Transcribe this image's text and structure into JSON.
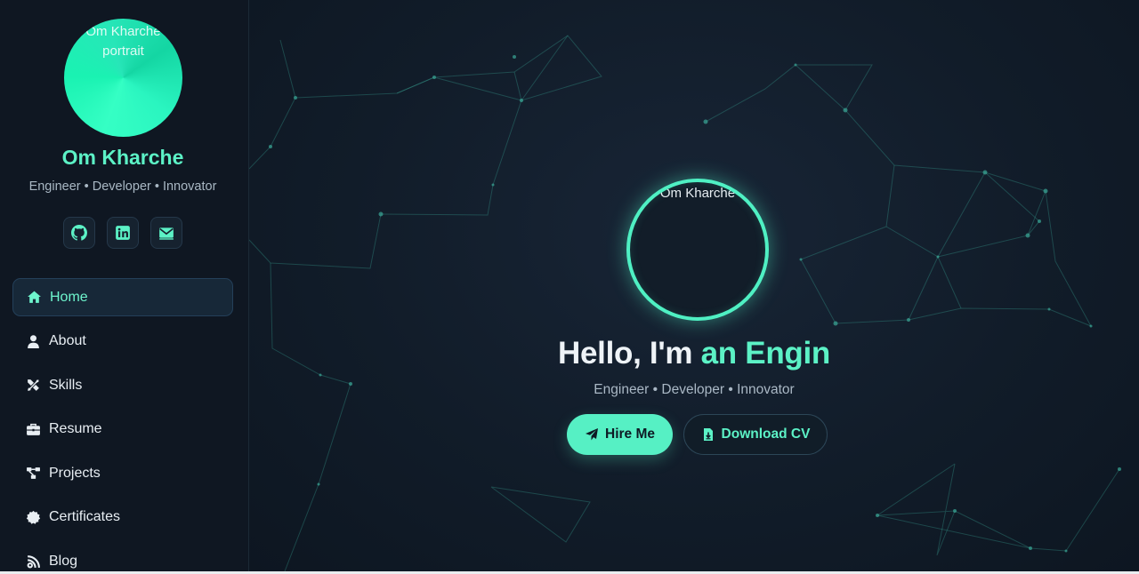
{
  "sidebar": {
    "avatar_alt": "Om Kharche portrait",
    "name": "Om Kharche",
    "tagline": "Engineer • Developer • Innovator",
    "socials": [
      {
        "icon": "github-icon"
      },
      {
        "icon": "linkedin-icon"
      },
      {
        "icon": "envelope-icon"
      }
    ],
    "nav": [
      {
        "label": "Home",
        "icon": "home-icon",
        "active": true
      },
      {
        "label": "About",
        "icon": "user-icon"
      },
      {
        "label": "Skills",
        "icon": "tools-icon"
      },
      {
        "label": "Resume",
        "icon": "briefcase-icon"
      },
      {
        "label": "Projects",
        "icon": "project-diagram-icon"
      },
      {
        "label": "Certificates",
        "icon": "certificate-badge-icon"
      },
      {
        "label": "Blog",
        "icon": "blog-icon"
      }
    ]
  },
  "hero": {
    "avatar_alt": "Om Kharche",
    "greeting": "Hello, I'm ",
    "typed_text": "an Engin",
    "tagline": "Engineer • Developer • Innovator",
    "buttons": {
      "hire": {
        "label": "Hire Me",
        "icon": "paper-plane-icon"
      },
      "cv": {
        "label": "Download CV",
        "icon": "file-download-icon"
      }
    }
  },
  "colors": {
    "accent": "#5cf2c6",
    "sidebar_bg": "#0f1722",
    "main_bg": "#111c29",
    "text": "#eef3f7",
    "muted": "#aab8c5"
  }
}
